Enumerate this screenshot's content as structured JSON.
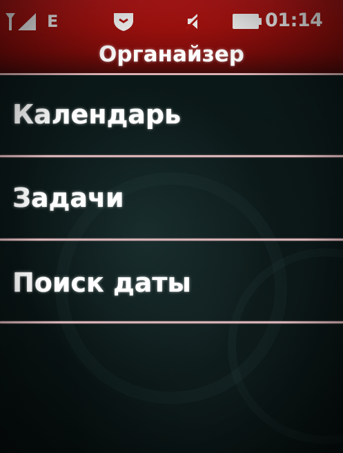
{
  "status_bar": {
    "signal_icon": "signal-strength-icon",
    "network_letter": "E",
    "network_icon": "edge-network-icon",
    "shield_icon": "shield-icon",
    "speaker_icon": "speaker-icon",
    "battery_icon": "battery-icon",
    "time": "01:14"
  },
  "header": {
    "title": "Органайзер"
  },
  "menu": {
    "items": [
      {
        "label": "Календарь"
      },
      {
        "label": "Задачи"
      },
      {
        "label": "Поиск даты"
      }
    ]
  },
  "colors": {
    "header_red": "#b5150f",
    "background": "#0a1515",
    "divider": "#d7b3b6",
    "text": "#ffffff"
  }
}
